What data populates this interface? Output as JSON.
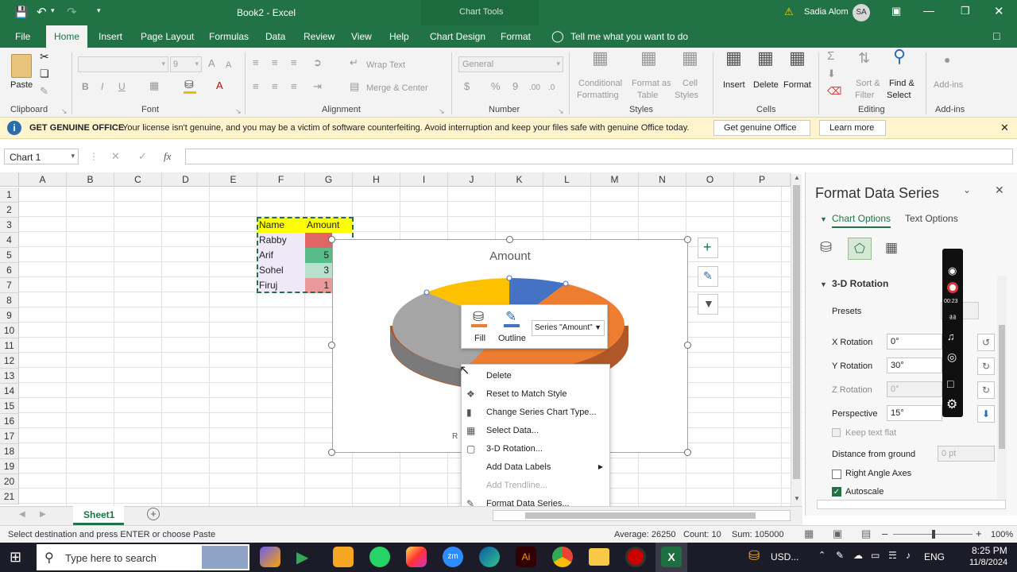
{
  "titlebar": {
    "doc_title": "Book2 - Excel",
    "context_title": "Chart Tools",
    "user_name": "Sadia Alom",
    "user_initials": "SA"
  },
  "tabs": [
    "File",
    "Home",
    "Insert",
    "Page Layout",
    "Formulas",
    "Data",
    "Review",
    "View",
    "Help",
    "Chart Design",
    "Format"
  ],
  "active_tab": "Home",
  "tell_me": "Tell me what you want to do",
  "ribbon": {
    "clipboard": {
      "label": "Clipboard",
      "paste": "Paste"
    },
    "font": {
      "label": "Font",
      "font_name": "",
      "font_size": "9"
    },
    "alignment": {
      "label": "Alignment",
      "wrap": "Wrap Text",
      "merge": "Merge & Center"
    },
    "number": {
      "label": "Number",
      "format": "General"
    },
    "styles": {
      "label": "Styles",
      "cond1": "Conditional",
      "cond2": "Formatting",
      "fmt1": "Format as",
      "fmt2": "Table",
      "cell1": "Cell",
      "cell2": "Styles"
    },
    "cells": {
      "label": "Cells",
      "insert": "Insert",
      "delete": "Delete",
      "format": "Format"
    },
    "editing": {
      "label": "Editing",
      "sort1": "Sort &",
      "sort2": "Filter",
      "find1": "Find &",
      "find2": "Select"
    },
    "addins": {
      "label": "Add-ins",
      "btn": "Add-ins"
    }
  },
  "warning": {
    "title": "GET GENUINE OFFICE",
    "message": "Your license isn't genuine, and you may be a victim of software counterfeiting. Avoid interruption and keep your files safe with genuine Office today.",
    "btn1": "Get genuine Office",
    "btn2": "Learn more"
  },
  "formula_bar": {
    "name_box": "Chart 1",
    "fx": "fx",
    "value": ""
  },
  "columns": [
    "A",
    "B",
    "C",
    "D",
    "E",
    "F",
    "G",
    "H",
    "I",
    "J",
    "K",
    "L",
    "M",
    "N",
    "O",
    "P"
  ],
  "rows": [
    "1",
    "2",
    "3",
    "4",
    "5",
    "6",
    "7",
    "8",
    "9",
    "10",
    "11",
    "12",
    "13",
    "14",
    "15",
    "16",
    "17",
    "18",
    "19",
    "20",
    "21"
  ],
  "table": {
    "header": [
      "Name",
      "Amount"
    ],
    "names": [
      "Rabby",
      "Arif",
      "Sohel",
      "Firuj"
    ],
    "amount_partial": [
      "",
      "5",
      "3",
      "1"
    ]
  },
  "chart": {
    "title": "Amount",
    "legend_partial": "R"
  },
  "mini_toolbar": {
    "fill": "Fill",
    "outline": "Outline",
    "series_select": "Series \"Amount\""
  },
  "context_menu": [
    {
      "label": "Delete",
      "enabled": true,
      "icon": "delete-icon"
    },
    {
      "label": "Reset to Match Style",
      "enabled": true,
      "icon": "reset-style-icon"
    },
    {
      "label": "Change Series Chart Type...",
      "enabled": true,
      "icon": "chart-type-icon"
    },
    {
      "label": "Select Data...",
      "enabled": true,
      "icon": "select-data-icon"
    },
    {
      "label": "3-D Rotation...",
      "enabled": true,
      "icon": "rotation-icon"
    },
    {
      "label": "Add Data Labels",
      "enabled": true,
      "icon": "",
      "submenu": true
    },
    {
      "label": "Add Trendline...",
      "enabled": false,
      "icon": ""
    },
    {
      "label": "Format Data Series...",
      "enabled": true,
      "icon": "format-series-icon"
    }
  ],
  "pane": {
    "title": "Format Data Series",
    "tab_chart": "Chart Options",
    "tab_text": "Text Options",
    "section": "3-D Rotation",
    "presets": "Presets",
    "x_rotation": {
      "label": "X Rotation",
      "value": "0°"
    },
    "y_rotation": {
      "label": "Y Rotation",
      "value": "30°"
    },
    "z_rotation": {
      "label": "Z Rotation",
      "value": "0°"
    },
    "perspective": {
      "label": "Perspective",
      "value": "15°"
    },
    "keep_text_flat": "Keep text flat",
    "distance": {
      "label": "Distance from ground",
      "value": "0 pt"
    },
    "right_angle": "Right Angle Axes",
    "autoscale": "Autoscale"
  },
  "sheet": {
    "tab": "Sheet1"
  },
  "status": {
    "message": "Select destination and press ENTER or choose Paste",
    "average": "Average: 26250",
    "count": "Count: 10",
    "sum": "Sum: 105000",
    "zoom": "100%"
  },
  "recorder": {
    "time": "00:23"
  },
  "taskbar": {
    "search": "Type here to search",
    "currency": "USD...",
    "lang": "ENG",
    "time": "8:25 PM",
    "date": "11/8/2024"
  },
  "colors": {
    "excel_green": "#217346",
    "pie_blue": "#4472c4",
    "pie_orange": "#ed7d31",
    "pie_gray": "#a5a5a5",
    "pie_yellow": "#ffc000",
    "header_yellow": "#ffff00"
  }
}
